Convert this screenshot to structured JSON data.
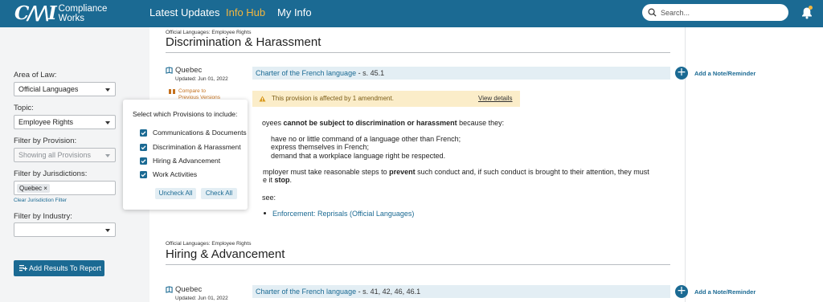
{
  "header": {
    "logo_mark": "C/\\/\\I",
    "logo_line1": "Compliance",
    "logo_line2": "Works",
    "nav": [
      "Latest Updates",
      "Info Hub",
      "My Info"
    ],
    "active_nav": "Info Hub",
    "search_placeholder": "Search...",
    "colors": {
      "brand": "#1b6a93",
      "accent": "#f4b63e"
    }
  },
  "sidebar": {
    "area_label": "Area of Law:",
    "area_value": "Official Languages",
    "topic_label": "Topic:",
    "topic_value": "Employee Rights",
    "provision_label": "Filter by Provision:",
    "provision_value": "Showing all Provisions",
    "jurisdiction_label": "Filter by Jurisdictions:",
    "jurisdiction_chip": "Quebec",
    "chip_remove": "×",
    "clear_link": "Clear Jurisdiction Filter",
    "industry_label": "Filter by Industry:",
    "industry_value": "",
    "add_button": "Add Results To Report"
  },
  "popover": {
    "title": "Select which Provisions to include:",
    "items": [
      {
        "label": "Communications & Documents",
        "checked": true
      },
      {
        "label": "Discrimination & Harassment",
        "checked": true
      },
      {
        "label": "Hiring & Advancement",
        "checked": true
      },
      {
        "label": "Work Activities",
        "checked": true
      }
    ],
    "uncheck_all": "Uncheck All",
    "check_all": "Check All"
  },
  "sections": [
    {
      "crumb": "Official Languages: Employee Rights",
      "title": "Discrimination & Harassment",
      "jurisdiction": "Quebec",
      "updated": "Updated: Jun 01, 2022",
      "compare_line1": "Compare to",
      "compare_line2": "Previous Versions",
      "law_link": "Charter of the French language",
      "law_suffix": " - s. 45.1",
      "amend_text": "This provision is affected by 1 amendment.",
      "amend_link": "View details",
      "para1_a": "oyees ",
      "para1_b": "cannot be subject to discrimination or harassment",
      "para1_c": " because they:",
      "list": [
        "have no or little command of a language other than French;",
        "express themselves in French;",
        "demand that a workplace language right be respected."
      ],
      "para2_line1_a": "mployer must take reasonable steps to ",
      "para2_line1_b": "prevent",
      "para2_line1_c": " such conduct and, if such conduct is brought to their attention, they must",
      "para2_line2_a": "e it ",
      "para2_line2_b": "stop",
      "para2_line2_c": ".",
      "see": "see:",
      "see_link": "Enforcement: Reprisals (Official Languages)",
      "note_label": "Add a Note/Reminder"
    },
    {
      "crumb": "Official Languages: Employee Rights",
      "title": "Hiring & Advancement",
      "jurisdiction": "Quebec",
      "updated": "Updated: Jun 01, 2022",
      "law_link": "Charter of the French language",
      "law_suffix": " - s. 41, 42, 46, 46.1",
      "note_label": "Add a Note/Reminder"
    }
  ]
}
